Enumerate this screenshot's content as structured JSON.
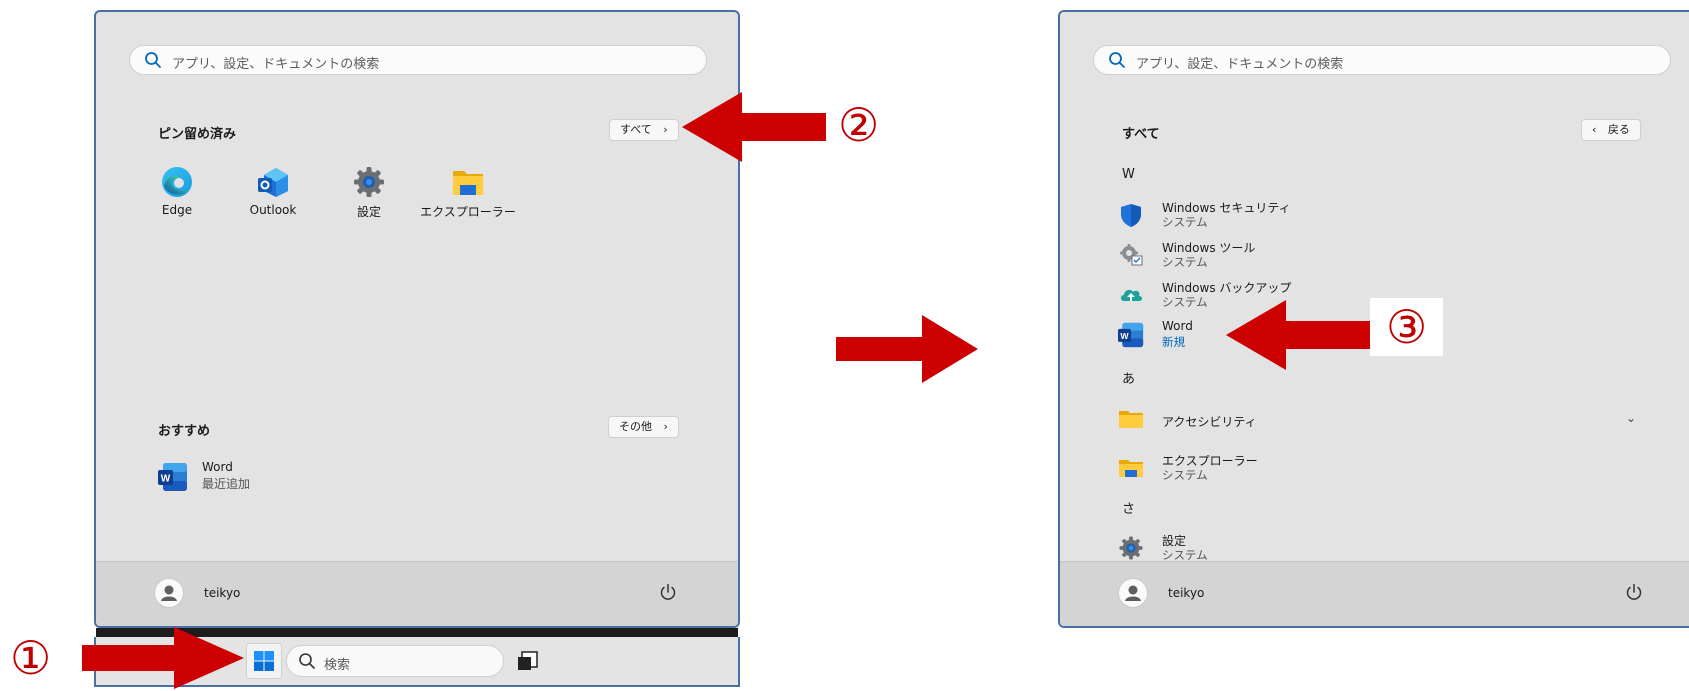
{
  "left_menu": {
    "search_placeholder": "アプリ、設定、ドキュメントの検索",
    "pinned_title": "ピン留め済み",
    "all_button": "すべて",
    "pinned_apps": [
      {
        "label": "Edge",
        "icon": "edge-icon"
      },
      {
        "label": "Outlook",
        "icon": "outlook-icon"
      },
      {
        "label": "設定",
        "icon": "settings-gear-icon"
      },
      {
        "label": "エクスプローラー",
        "icon": "folder-icon"
      }
    ],
    "recommended_title": "おすすめ",
    "more_button": "その他",
    "recommended_items": [
      {
        "title": "Word",
        "subtitle": "最近追加",
        "icon": "word-icon"
      }
    ],
    "user_name": "teikyo"
  },
  "right_menu": {
    "search_placeholder": "アプリ、設定、ドキュメントの検索",
    "title": "すべて",
    "back_button": "戻る",
    "groups": [
      {
        "letter": "W",
        "apps": [
          {
            "name": "Windows セキュリティ",
            "sub": "システム",
            "icon": "shield-icon"
          },
          {
            "name": "Windows ツール",
            "sub": "システム",
            "icon": "tools-gear-icon"
          },
          {
            "name": "Windows バックアップ",
            "sub": "システム",
            "icon": "cloud-upload-icon"
          },
          {
            "name": "Word",
            "sub": "新規",
            "icon": "word-icon"
          }
        ]
      },
      {
        "letter": "あ",
        "apps": [
          {
            "name": "アクセシビリティ",
            "sub": "",
            "icon": "folder-icon"
          },
          {
            "name": "エクスプローラー",
            "sub": "システム",
            "icon": "folder-icon"
          }
        ]
      },
      {
        "letter": "さ",
        "apps": [
          {
            "name": "設定",
            "sub": "システム",
            "icon": "settings-gear-icon"
          }
        ]
      }
    ],
    "user_name": "teikyo"
  },
  "taskbar": {
    "search_placeholder": "検索"
  },
  "annotations": {
    "step1": "①",
    "step2": "②",
    "step3": "③"
  },
  "colors": {
    "arrow": "#cc0000",
    "menu_bg": "#e3e3e3",
    "border": "#4a6fa5",
    "new_badge": "#0067c0"
  }
}
